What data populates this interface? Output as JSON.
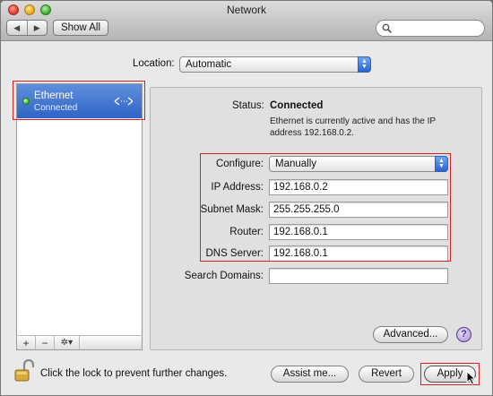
{
  "window": {
    "title": "Network"
  },
  "toolbar": {
    "back_label": "◀",
    "forward_label": "▶",
    "show_all_label": "Show All",
    "search_placeholder": ""
  },
  "location": {
    "label": "Location:",
    "value": "Automatic"
  },
  "services": [
    {
      "name": "Ethernet",
      "status": "Connected"
    }
  ],
  "list_controls": {
    "add": "+",
    "remove": "−",
    "action": "✲▾"
  },
  "status": {
    "label": "Status:",
    "value": "Connected",
    "description": "Ethernet is currently active and has the IP address 192.168.0.2."
  },
  "config": {
    "configure_label": "Configure:",
    "configure_value": "Manually",
    "ip_label": "IP Address:",
    "ip_value": "192.168.0.2",
    "subnet_label": "Subnet Mask:",
    "subnet_value": "255.255.255.0",
    "router_label": "Router:",
    "router_value": "192.168.0.1",
    "dns_label": "DNS Server:",
    "dns_value": "192.168.0.1",
    "search_domains_label": "Search Domains:",
    "search_domains_value": ""
  },
  "buttons": {
    "advanced": "Advanced...",
    "help": "?",
    "assist": "Assist me...",
    "revert": "Revert",
    "apply": "Apply"
  },
  "lock": {
    "text": "Click the lock to prevent further changes."
  },
  "colors": {
    "selection": "#2f64c6",
    "highlight_box": "#d61f26",
    "popup_arrow": "#2a63d2"
  },
  "icons": [
    "search-icon",
    "lock-icon",
    "ethernet-arrows-icon",
    "gear-icon",
    "cursor-icon"
  ]
}
